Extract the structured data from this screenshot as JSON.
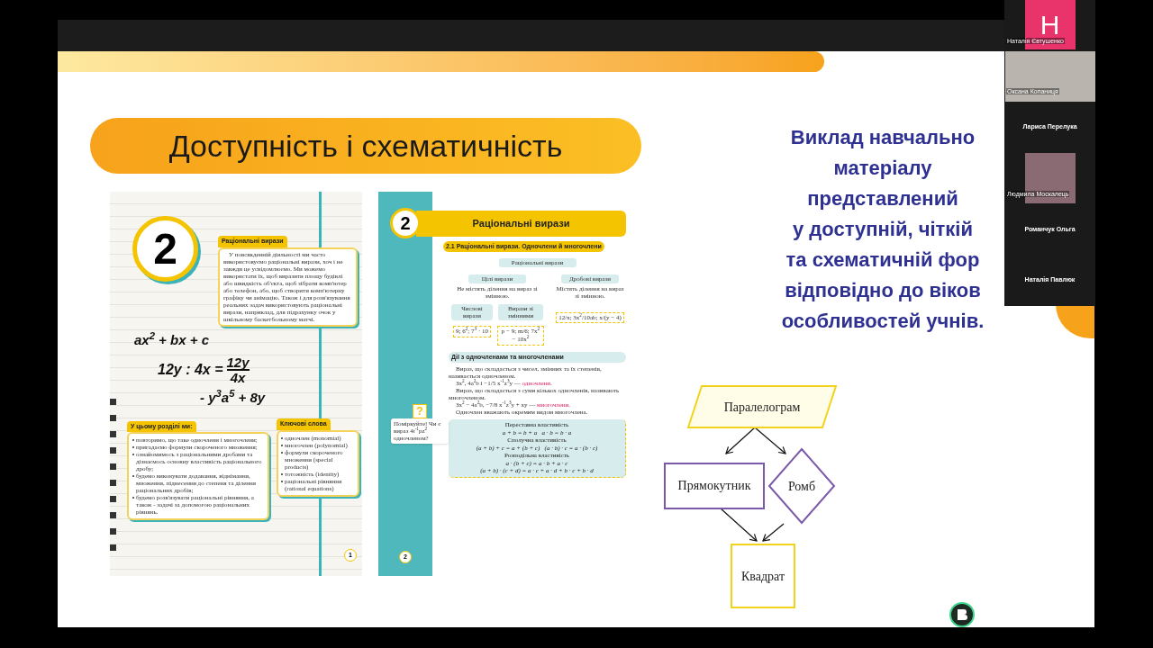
{
  "participants": [
    {
      "kind": "avatar",
      "initial": "Н",
      "name": "Наталія Євтушенко"
    },
    {
      "kind": "video",
      "name": "Оксана Копаниця"
    },
    {
      "kind": "name",
      "name": "Лариса Перелука"
    },
    {
      "kind": "video",
      "name": "Людмила Москалець"
    },
    {
      "kind": "name",
      "name": "Романчук Ольга"
    },
    {
      "kind": "name",
      "name": "Наталія Павлюк"
    }
  ],
  "slide": {
    "title": "Доступність і схематичність",
    "description_lines": [
      "Виклад навчально",
      "матеріалу",
      "представлений",
      "у доступній, чіткій",
      "та схематичній фор",
      "відповідно до віков",
      "особливостей учнів."
    ],
    "textbook_page_1": {
      "chapter_number": "2",
      "intro_title": "Раціональні вирази",
      "intro_text": "У повсякденній діяльності ми часто використовуємо раціональні вирази, хоч і не завжди це усвідомлюємо. Ми можемо використати їх, щоб виразити площу будівлі або швидкість об'єкта, щоб зібрати комп'ютер або телефон, або, щоб створити комп'ютерну графіку чи анімацію. Також і для розв'язування реальних задач використовують раціональні вирази, наприклад, для підрахунку очок у шкільному баскетбольному матчі.",
      "formula_1": "ax$^{2}$ + bx + c",
      "formula_2": "12y : 4x =",
      "formula_2_numerator": "12y",
      "formula_2_denominator": "4x",
      "formula_3": "- y$^{3}$a$^{5}$ + 8y",
      "goals_title": "У цьому розділі ми:",
      "goals": [
        "повторимо, що таке одночлени і многочлени;",
        "пригадаємо формули скороченого множення;",
        "ознайомимось з раціональними дробами та дізнаємось основну властивість раціонального дробу;",
        "будемо виконувати додавання, віднімання, множення, піднесення до степеня та ділення раціональних дробів;",
        "будемо розв'язувати раціональні рівняння, а також - задачі за допомогою раціональних рівнянь."
      ],
      "keywords_title": "Ключові слова",
      "keywords": [
        "одночлен (monomial)",
        "многочлен (polynomial)",
        "формули скороченого множення (special products)",
        "тотожність (identity)",
        "раціональні рівняння (rational equations)"
      ],
      "page_number": "1"
    },
    "textbook_page_2": {
      "chapter_number": "2",
      "chapter_title": "Раціональні вирази",
      "section_title": "2.1 Раціональні вирази. Одночлени й многочлени",
      "scheme_root": "Раціональні вирази",
      "scheme_left": "Цілі вирази",
      "scheme_left_note": "Не містять ділення на вираз зі змінною.",
      "scheme_right": "Дробові вирази",
      "scheme_right_note": "Містять ділення на вираз зі змінною.",
      "scheme_numeric": "Числові вирази",
      "scheme_variable": "Вирази зі змінними",
      "example_numeric": "9; 6$^{2}$; 7$^{3}$ · 10",
      "example_variable": "p − 9; m/6; 7x$^{2}$ − 10x$^{2}$",
      "example_fraction": "12/x; 3x$^{2}$/10ab; x/(y − 4)",
      "operations_title": "Дії з одночленами та многочленами",
      "paragraph_1": "Вираз, що складається з чисел, змінних та їх степенів, називається одночленом.",
      "example_1": "3x$^{2}$, 4a$^{2}$b і −1/5 x$^{-1}$z$^{3}$y —",
      "example_1_term": "одночлени.",
      "paragraph_2": "Вираз, що складається з суми кількох одночленів, називають многочленом.",
      "example_2": "3x$^{2}$ − 4a$^{2}$b, −7/8 x$^{-1}$z$^{3}$y + xy —",
      "example_2_term": "многочлени.",
      "paragraph_3": "Одночлен вважають окремим видом многочлена.",
      "properties": [
        "Переставна властивість",
        "a + b = b + a   a · b = b · a",
        "Сполучна властивість",
        "(a + b) + c = a + (b + c)   (a · b) · c = a · (b · c)",
        "Розподільна властивість",
        "a · (b + c) = a · b + a · c",
        "(a + b) · (c + d) = a · c + a · d + b · c + b · d"
      ],
      "question_mark": "?",
      "question": "Поміркуйте! Чи є вираз 4t$^{-1}$pz$^{2}$ одночленом?",
      "page_number": "2"
    },
    "diagram": {
      "nodes": [
        {
          "kind": "parallelogram",
          "label": "Паралелограм",
          "color": "#f2d31b"
        },
        {
          "kind": "rectangle",
          "label": "Прямокутник",
          "color": "#7a5aa8"
        },
        {
          "kind": "diamond",
          "label": "Ромб",
          "color": "#7a5aa8"
        },
        {
          "kind": "square",
          "label": "Квадрат",
          "color": "#f2d31b"
        }
      ]
    }
  }
}
